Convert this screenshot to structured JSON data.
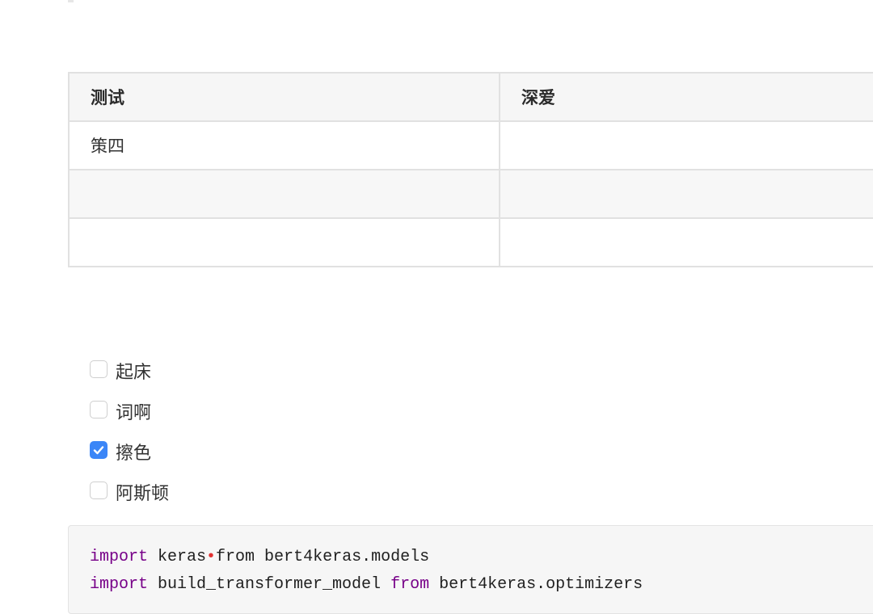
{
  "table": {
    "headers": [
      "测试",
      "深爱"
    ],
    "rows": [
      [
        "策四",
        ""
      ],
      [
        "",
        ""
      ],
      [
        "",
        ""
      ]
    ]
  },
  "tasks": [
    {
      "label": "起床",
      "checked": false
    },
    {
      "label": "词啊",
      "checked": false
    },
    {
      "label": "擦色",
      "checked": true
    },
    {
      "label": "阿斯顿",
      "checked": false
    }
  ],
  "code": {
    "line1": {
      "kw1": "import",
      "text1": " keras",
      "bullet": "•",
      "text2": "from bert4keras.models"
    },
    "line2": {
      "kw1": "import",
      "text1": " build_transformer_model ",
      "kw2": "from",
      "text2": " bert4keras.optimizers"
    }
  },
  "colors": {
    "checkbox_checked": "#3b86f7",
    "keyword": "#770088",
    "bullet": "#e03030"
  }
}
